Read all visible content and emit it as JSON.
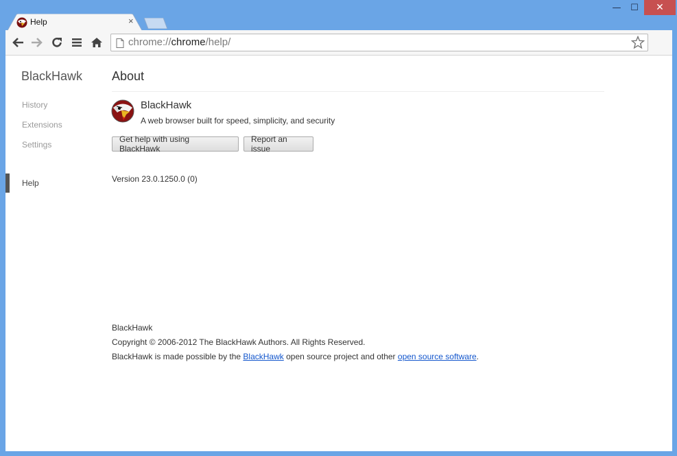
{
  "tabs": [
    {
      "title": "Help",
      "close": "×"
    }
  ],
  "window_controls": {
    "minimize": "—",
    "maximize": "☐",
    "close": "✕"
  },
  "omnibox": {
    "scheme": "chrome://",
    "host": "chrome",
    "path": "/help/"
  },
  "sidebar": {
    "title": "BlackHawk",
    "items": [
      {
        "label": "History"
      },
      {
        "label": "Extensions"
      },
      {
        "label": "Settings"
      },
      {
        "label": "Help",
        "selected": true
      }
    ]
  },
  "main": {
    "title": "About",
    "product_name": "BlackHawk",
    "product_desc": "A web browser built for speed, simplicity, and security",
    "help_button": "Get help with using BlackHawk",
    "report_button": "Report an issue",
    "version": "Version 23.0.1250.0 (0)"
  },
  "footer": {
    "name": "BlackHawk",
    "copyright": "Copyright © 2006-2012 The BlackHawk Authors. All Rights Reserved.",
    "credits_prefix": "BlackHawk is made possible by the ",
    "credits_link1": "BlackHawk",
    "credits_mid": " open source project and other ",
    "credits_link2": "open source software",
    "credits_suffix": "."
  },
  "icons": [
    "back-arrow-icon",
    "forward-arrow-icon",
    "reload-icon",
    "menu-icon",
    "home-icon",
    "page-icon",
    "star-icon",
    "eagle-logo-icon"
  ],
  "colors": {
    "frame": "#6aa5e6",
    "link": "#1155cc",
    "selected_bar": "#555555"
  }
}
